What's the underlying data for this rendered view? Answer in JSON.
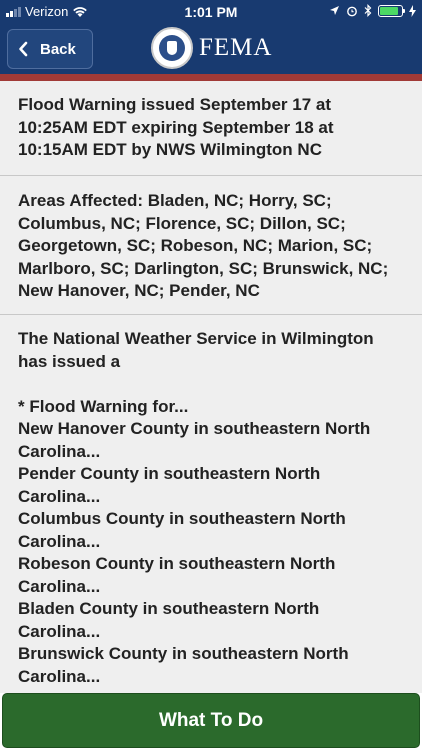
{
  "status_bar": {
    "carrier": "Verizon",
    "time": "1:01 PM"
  },
  "header": {
    "back_label": "Back",
    "logo_text": "FEMA",
    "colors": {
      "bar": "#183a70",
      "accent": "#a13a37"
    }
  },
  "alert": {
    "summary": "Flood Warning issued September 17 at 10:25AM EDT expiring September 18 at 10:15AM EDT by NWS Wilmington NC",
    "areas": "Areas Affected: Bladen, NC; Horry, SC; Columbus, NC; Florence, SC; Dillon, SC; Georgetown, SC; Robeson, NC; Marion, SC; Marlboro, SC; Darlington, SC; Brunswick, NC; New Hanover, NC; Pender, NC",
    "description": "The National Weather Service in Wilmington has issued a\n\n* Flood Warning for...\nNew Hanover County in southeastern North Carolina...\nPender County in southeastern North Carolina...\nColumbus County in southeastern North Carolina...\nRobeson County in southeastern North Carolina...\nBladen County in southeastern North Carolina...\nBrunswick County in southeastern North Carolina..."
  },
  "footer": {
    "what_to_do_label": "What To Do",
    "color": "#2b6a2c"
  }
}
